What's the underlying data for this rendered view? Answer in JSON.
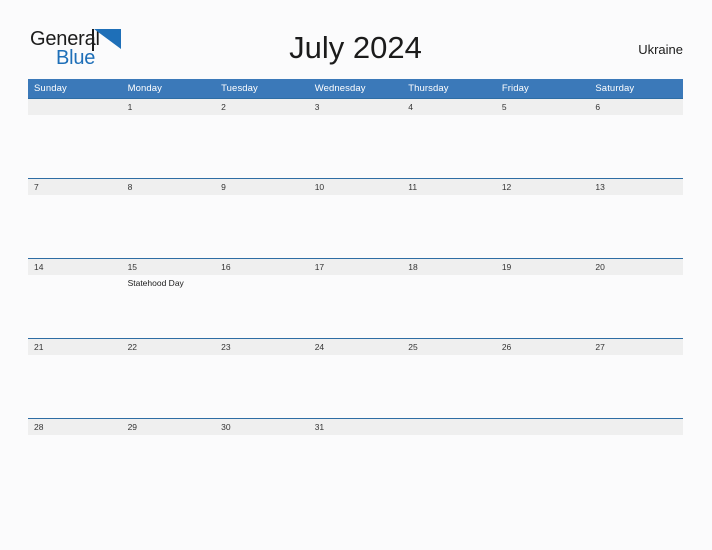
{
  "brand": {
    "name_part1": "General",
    "name_part2": "Blue",
    "accent_color": "#1e6fb8",
    "triangle_icon": "triangle-flag-icon"
  },
  "header": {
    "title": "July 2024",
    "country": "Ukraine"
  },
  "calendar": {
    "month": "July",
    "year": "2024",
    "header_bg": "#3b79b9",
    "row_border_color": "#2e6da4",
    "daynum_bg": "#efefef",
    "weekday_headers": [
      "Sunday",
      "Monday",
      "Tuesday",
      "Wednesday",
      "Thursday",
      "Friday",
      "Saturday"
    ],
    "weeks": [
      [
        {
          "day": "",
          "events": []
        },
        {
          "day": "1",
          "events": []
        },
        {
          "day": "2",
          "events": []
        },
        {
          "day": "3",
          "events": []
        },
        {
          "day": "4",
          "events": []
        },
        {
          "day": "5",
          "events": []
        },
        {
          "day": "6",
          "events": []
        }
      ],
      [
        {
          "day": "7",
          "events": []
        },
        {
          "day": "8",
          "events": []
        },
        {
          "day": "9",
          "events": []
        },
        {
          "day": "10",
          "events": []
        },
        {
          "day": "11",
          "events": []
        },
        {
          "day": "12",
          "events": []
        },
        {
          "day": "13",
          "events": []
        }
      ],
      [
        {
          "day": "14",
          "events": []
        },
        {
          "day": "15",
          "events": [
            "Statehood Day"
          ]
        },
        {
          "day": "16",
          "events": []
        },
        {
          "day": "17",
          "events": []
        },
        {
          "day": "18",
          "events": []
        },
        {
          "day": "19",
          "events": []
        },
        {
          "day": "20",
          "events": []
        }
      ],
      [
        {
          "day": "21",
          "events": []
        },
        {
          "day": "22",
          "events": []
        },
        {
          "day": "23",
          "events": []
        },
        {
          "day": "24",
          "events": []
        },
        {
          "day": "25",
          "events": []
        },
        {
          "day": "26",
          "events": []
        },
        {
          "day": "27",
          "events": []
        }
      ],
      [
        {
          "day": "28",
          "events": []
        },
        {
          "day": "29",
          "events": []
        },
        {
          "day": "30",
          "events": []
        },
        {
          "day": "31",
          "events": []
        },
        {
          "day": "",
          "events": []
        },
        {
          "day": "",
          "events": []
        },
        {
          "day": "",
          "events": []
        }
      ]
    ]
  }
}
